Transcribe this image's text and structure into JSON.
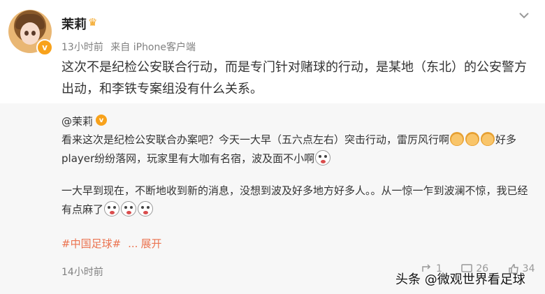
{
  "post": {
    "author": "茉莉",
    "time": "13小时前",
    "source": "来自 iPhone客户端",
    "text": "这次不是纪检公安联合行动，而是专门针对赌球的行动，是某地（东北）的公安警方出动，和李铁专案组没有什么关系。"
  },
  "quoted": {
    "author": "@茉莉",
    "line1_pre": "看来这次是纪检公安联合办案吧？今天一大早（五六点左右）突击行动，雷厉风行啊",
    "line1_post": "好多",
    "line2": "player纷纷落网，玩家里有大咖有名宿，波及面不小啊",
    "line3": "一大早到现在，不断地收到新的消息，没想到波及好多地方好多人。。从一惊一乍到波澜不惊，我已经",
    "line4": "有点麻了",
    "tag": "#中国足球#",
    "ellipsis": "...",
    "expand": "展开",
    "time": "14小时前",
    "repost_count": "1",
    "comment_count": "26",
    "like_count": "34"
  },
  "watermark": "头条 @微观世界看足球",
  "colors": {
    "link": "#eb7350",
    "badge": "#f8a21b",
    "quote_bg": "#f7f7f7"
  }
}
